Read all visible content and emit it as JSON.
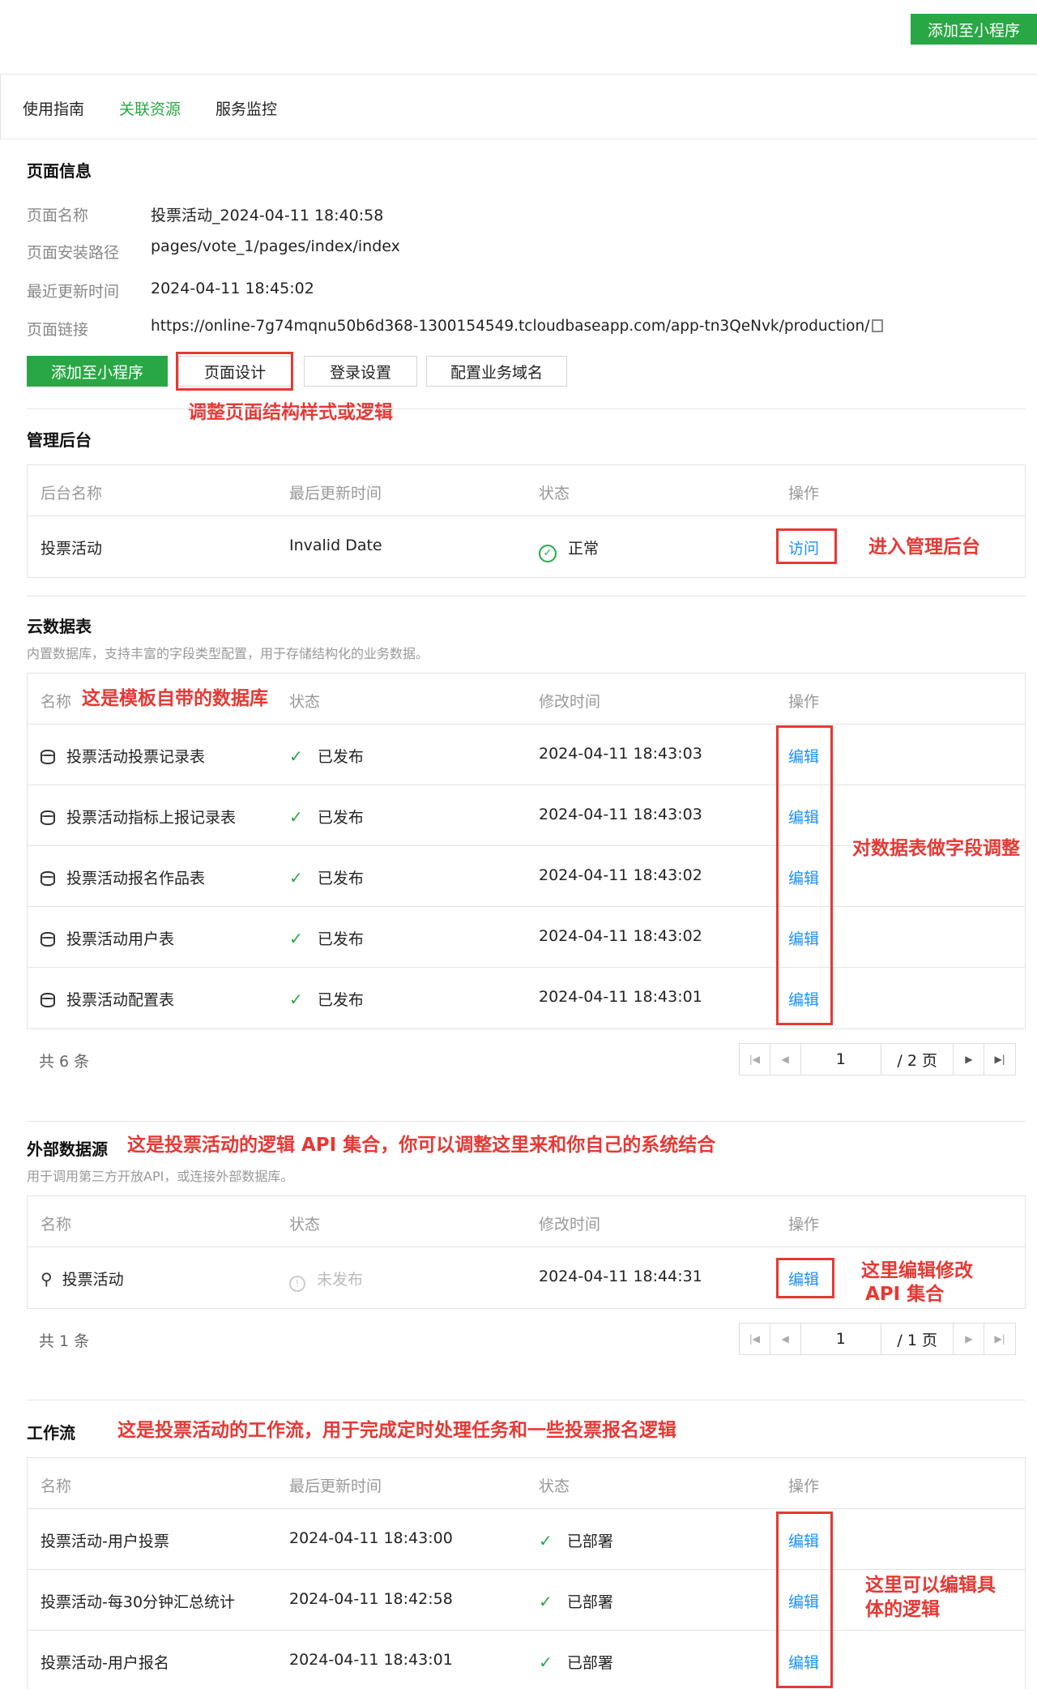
{
  "top_button": "添加至小程序",
  "tabs": [
    "使用指南",
    "关联资源",
    "服务监控"
  ],
  "page_info": {
    "title": "页面信息",
    "fields": [
      {
        "label": "页面名称",
        "value": "投票活动_2024-04-11 18:40:58"
      },
      {
        "label": "页面安装路径",
        "value": "pages/vote_1/pages/index/index"
      },
      {
        "label": "最近更新时间",
        "value": "2024-04-11 18:45:02"
      },
      {
        "label": "页面链接",
        "value": "https://online-7g74mqnu50b6d368-1300154549.tcloudbaseapp.com/app-tn3QeNvk/production/"
      }
    ],
    "buttons": [
      "添加至小程序",
      "页面设计",
      "登录设置",
      "配置业务域名"
    ],
    "annotation": "调整页面结构样式或逻辑"
  },
  "admin": {
    "title": "管理后台",
    "headers": [
      "后台名称",
      "最后更新时间",
      "状态",
      "操作"
    ],
    "rows": [
      {
        "name": "投票活动",
        "updated": "Invalid Date",
        "status": "正常",
        "action": "访问"
      }
    ],
    "annotation": "进入管理后台"
  },
  "cloud_db": {
    "title": "云数据表",
    "desc": "内置数据库，支持丰富的字段类型配置，用于存储结构化的业务数据。",
    "headers": [
      "名称",
      "状态",
      "修改时间",
      "操作"
    ],
    "rows": [
      {
        "name": "投票活动投票记录表",
        "status": "已发布",
        "time": "2024-04-11 18:43:03",
        "action": "编辑"
      },
      {
        "name": "投票活动指标上报记录表",
        "status": "已发布",
        "time": "2024-04-11 18:43:03",
        "action": "编辑"
      },
      {
        "name": "投票活动报名作品表",
        "status": "已发布",
        "time": "2024-04-11 18:43:02",
        "action": "编辑"
      },
      {
        "name": "投票活动用户表",
        "status": "已发布",
        "time": "2024-04-11 18:43:02",
        "action": "编辑"
      },
      {
        "name": "投票活动配置表",
        "status": "已发布",
        "time": "2024-04-11 18:43:01",
        "action": "编辑"
      }
    ],
    "total": "共 6 条",
    "pager_page": "1",
    "pager_total": "/ 2 页",
    "annotation_header": "这是模板自带的数据库",
    "annotation_side": "对数据表做字段调整"
  },
  "external": {
    "title": "外部数据源",
    "annotation": "这是投票活动的逻辑 API 集合，你可以调整这里来和你自己的系统结合",
    "desc": "用于调用第三方开放API，或连接外部数据库。",
    "headers": [
      "名称",
      "状态",
      "修改时间",
      "操作"
    ],
    "rows": [
      {
        "name": "投票活动",
        "status": "未发布",
        "time": "2024-04-11 18:44:31",
        "action": "编辑"
      }
    ],
    "total": "共 1 条",
    "pager_page": "1",
    "pager_total": "/ 1 页",
    "annotation_side_1": "这里编辑修改",
    "annotation_side_2": "API 集合"
  },
  "workflow": {
    "title": "工作流",
    "annotation": "这是投票活动的工作流，用于完成定时处理任务和一些投票报名逻辑",
    "headers": [
      "名称",
      "最后更新时间",
      "状态",
      "操作"
    ],
    "rows": [
      {
        "name": "投票活动-用户投票",
        "time": "2024-04-11 18:43:00",
        "status": "已部署",
        "action": "编辑"
      },
      {
        "name": "投票活动-每30分钟汇总统计",
        "time": "2024-04-11 18:42:58",
        "status": "已部署",
        "action": "编辑"
      },
      {
        "name": "投票活动-用户报名",
        "time": "2024-04-11 18:43:01",
        "status": "已部署",
        "action": "编辑"
      }
    ],
    "annotation_side_1": "这里可以编辑具",
    "annotation_side_2": "体的逻辑"
  },
  "colors": {
    "accent": "#29a745",
    "link": "#1a90ff",
    "annotation": "#e53935"
  }
}
